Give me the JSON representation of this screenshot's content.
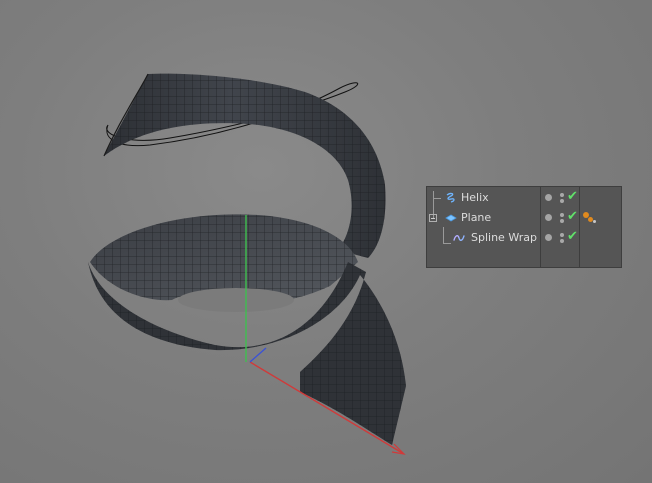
{
  "viewport": {
    "axes": {
      "x_color": "#d03a3a",
      "y_color": "#3fbf4f",
      "z_color": "#3b52d6"
    }
  },
  "object_manager": {
    "objects": [
      {
        "name": "Helix",
        "icon": "helix-spline-icon",
        "visible": true,
        "enabled": true
      },
      {
        "name": "Plane",
        "icon": "plane-object-icon",
        "visible": true,
        "enabled": true,
        "tag": "phong-tag-icon"
      },
      {
        "name": "Spline Wrap",
        "icon": "spline-wrap-deformer-icon",
        "visible": true,
        "enabled": true
      }
    ],
    "enabled_color": "#61e06a"
  }
}
